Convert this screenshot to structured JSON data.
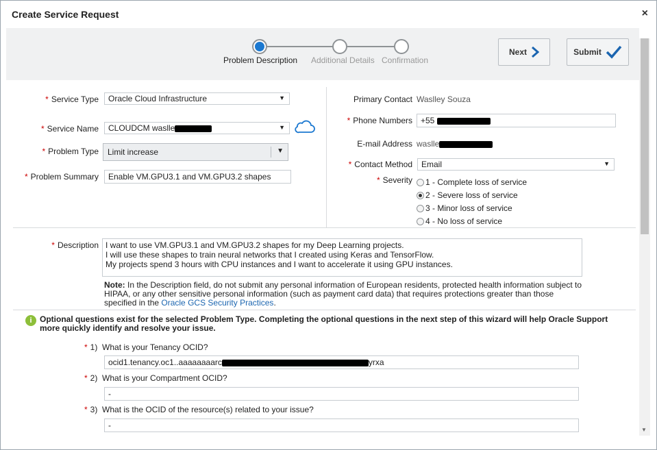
{
  "dialog": {
    "title": "Create Service Request",
    "close_label": "×"
  },
  "train": {
    "steps": [
      {
        "label": "Problem Description",
        "active": true
      },
      {
        "label": "Additional Details",
        "active": false
      },
      {
        "label": "Confirmation",
        "active": false
      }
    ]
  },
  "buttons": {
    "next_label": "Next",
    "submit_label": "Submit"
  },
  "form": {
    "service_type": {
      "label": "Service Type",
      "value": "Oracle Cloud Infrastructure"
    },
    "service_name": {
      "label": "Service Name",
      "value": "CLOUDCM waslle"
    },
    "problem_type": {
      "label": "Problem Type",
      "value": "Limit increase"
    },
    "problem_summary": {
      "label": "Problem Summary",
      "value": "Enable VM.GPU3.1 and VM.GPU3.2 shapes"
    },
    "primary_contact": {
      "label": "Primary Contact",
      "value": "Waslley Souza"
    },
    "phone_numbers": {
      "label": "Phone Numbers",
      "value": "+55"
    },
    "email": {
      "label": "E-mail Address",
      "value": "waslle"
    },
    "contact_method": {
      "label": "Contact Method",
      "value": "Email"
    },
    "severity": {
      "label": "Severity",
      "options": [
        {
          "label": "1 - Complete loss of service",
          "selected": false
        },
        {
          "label": "2 - Severe loss of service",
          "selected": true
        },
        {
          "label": "3 - Minor loss of service",
          "selected": false
        },
        {
          "label": "4 - No loss of service",
          "selected": false
        }
      ]
    },
    "description": {
      "label": "Description",
      "lines": [
        "I want to use VM.GPU3.1 and VM.GPU3.2 shapes for my Deep Learning projects.",
        "I will use these shapes to train neural networks that I created using Keras and TensorFlow.",
        "My projects spend 3 hours with CPU instances and I want to accelerate it using GPU instances."
      ]
    },
    "note": {
      "prefix": "Note:",
      "text": " In the Description field, do not submit any personal information of European residents, protected health information subject to HIPAA, or any other sensitive personal information (such as payment card data) that requires protections greater than those specified in the ",
      "link": "Oracle GCS Security Practices",
      "suffix": "."
    }
  },
  "optional": {
    "info": "Optional questions exist for the selected Problem Type. Completing the optional questions in the next step of this wizard will help Oracle Support more quickly identify and resolve your issue.",
    "questions": [
      {
        "number": "1)",
        "text": "What is your Tenancy OCID?",
        "value_start": "ocid1.tenancy.oc1..aaaaaaaarc",
        "value_end": "yrxa"
      },
      {
        "number": "2)",
        "text": "What is your Compartment OCID?",
        "value": "-"
      },
      {
        "number": "3)",
        "text": "What is the OCID of the resource(s) related to your issue?",
        "value": "-"
      }
    ]
  },
  "required_mark": "*",
  "colors": {
    "accent": "#1b78d0",
    "required": "#cc0000",
    "link": "#1b65b0",
    "info": "#8dbf3a"
  }
}
